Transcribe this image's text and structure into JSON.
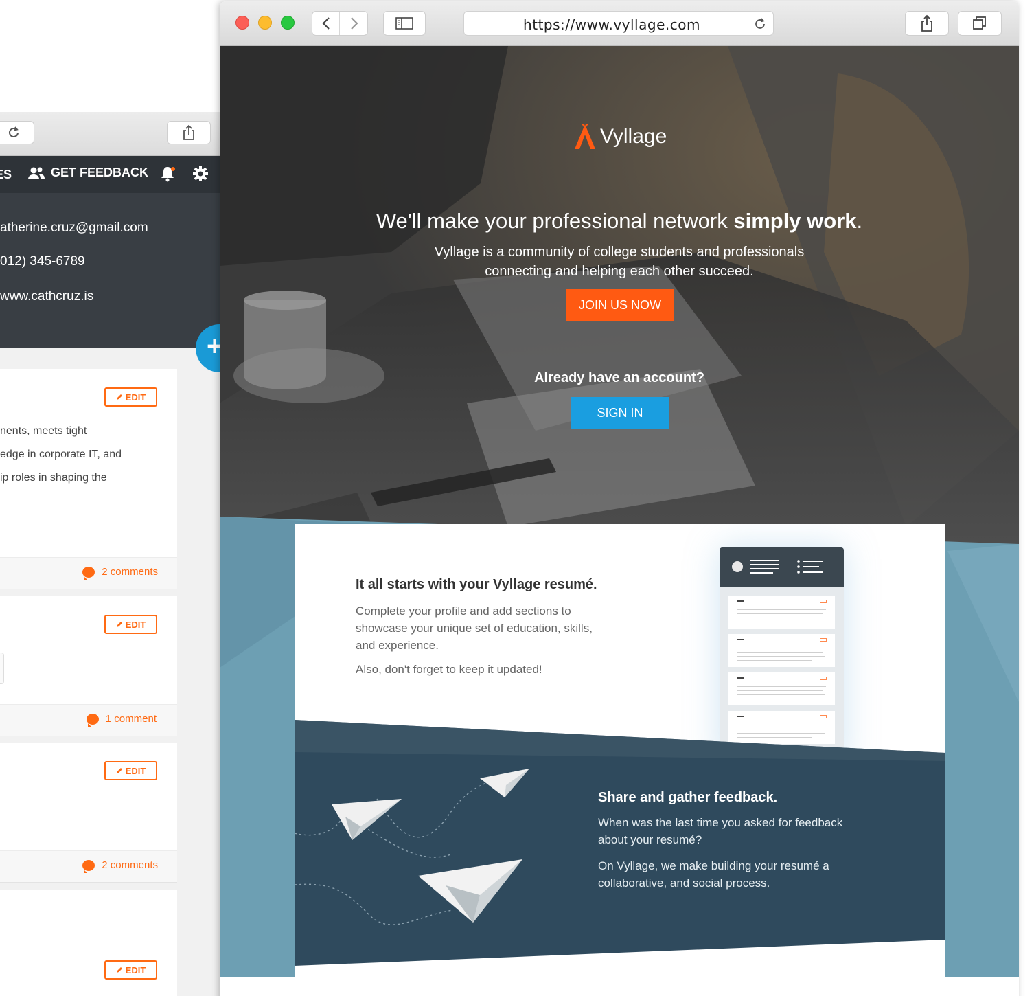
{
  "back_window": {
    "nav": {
      "cut_item": "ES",
      "feedback_label": "GET FEEDBACK"
    },
    "profile": {
      "email": "atherine.cruz@gmail.com",
      "phone": "012) 345-6789",
      "website": "www.cathcruz.is"
    },
    "cards": [
      {
        "edit_label": "EDIT",
        "lines": [
          "nents, meets tight",
          "edge in corporate IT, and",
          "ip roles in shaping the"
        ],
        "comments": "2 comments"
      },
      {
        "edit_label": "EDIT",
        "comments": "1 comment"
      },
      {
        "edit_label": "EDIT",
        "comments": "2 comments"
      },
      {
        "edit_label": "EDIT"
      }
    ]
  },
  "front_window": {
    "url": "https://www.vyllage.com",
    "hero": {
      "logo_text": "Vyllage",
      "headline_regular": "We'll make your professional network ",
      "headline_bold": "simply work",
      "headline_end": ".",
      "subtext": "Vyllage is a community of college students and professionals connecting and helping each other succeed.",
      "join_label": "JOIN US NOW",
      "account_question": "Already have an account?",
      "signin_label": "SIGN IN"
    },
    "resume_section": {
      "title": "It all starts with your Vyllage resumé.",
      "paragraph1": "Complete your profile and add sections to showcase your unique set of education, skills, and experience.",
      "paragraph2": "Also, don't forget to keep it updated!"
    },
    "feedback_section": {
      "title": "Share and gather feedback.",
      "paragraph1": "When was the last time you asked for feedback about your resumé?",
      "paragraph2": "On Vyllage, we make building your resumé a collaborative, and social process."
    }
  },
  "colors": {
    "brand_orange": "#ff5a12",
    "signin_blue": "#1a9ee0",
    "dark_band": "#2f4a5d",
    "steel_blue": "#6d9fb3"
  }
}
